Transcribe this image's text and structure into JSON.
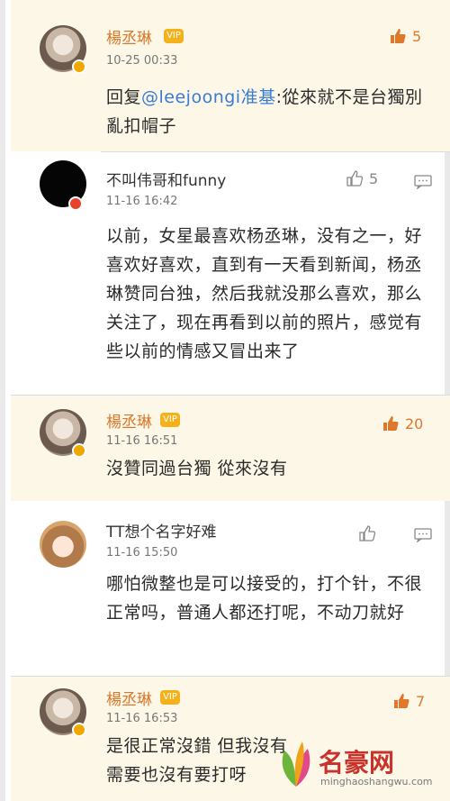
{
  "comments": [
    {
      "name": "楊丞琳",
      "time": "10-25 00:33",
      "like_count": "5",
      "content_prefix": "回复",
      "mention": "@leejoongi准基",
      "content_suffix": ":從來就不是台獨別亂扣帽子",
      "vip_label": "VIP"
    },
    {
      "name": "不叫伟哥和funny",
      "time": "11-16 16:42",
      "like_count": "5",
      "content": "以前，女星最喜欢杨丞琳，没有之一，好喜欢好喜欢，直到有一天看到新闻，杨丞琳赞同台独，然后我就没那么喜欢，那么关注了，现在再看到以前的照片，感觉有些以前的情感又冒出来了"
    },
    {
      "name": "楊丞琳",
      "time": "11-16 16:51",
      "like_count": "20",
      "content": "沒贊同過台獨 從來沒有",
      "vip_label": "VIP"
    },
    {
      "name": "TT想个名字好难",
      "time": "11-16 15:50",
      "content": "哪怕微整也是可以接受的，打个针，不很正常吗，普通人都还打呢，不动刀就好"
    },
    {
      "name": "楊丞琳",
      "time": "11-16 16:53",
      "like_count": "7",
      "content": "是很正常沒錯 但我沒有需要也沒有要打呀",
      "vip_label": "VIP"
    }
  ],
  "watermark": {
    "title": "名豪网",
    "subtitle": "minghaoshangwu.com"
  },
  "colors": {
    "accent_orange": "#d9782b",
    "highlight_bg": "#fcf7e6",
    "mention_blue": "#3a7bd5"
  }
}
